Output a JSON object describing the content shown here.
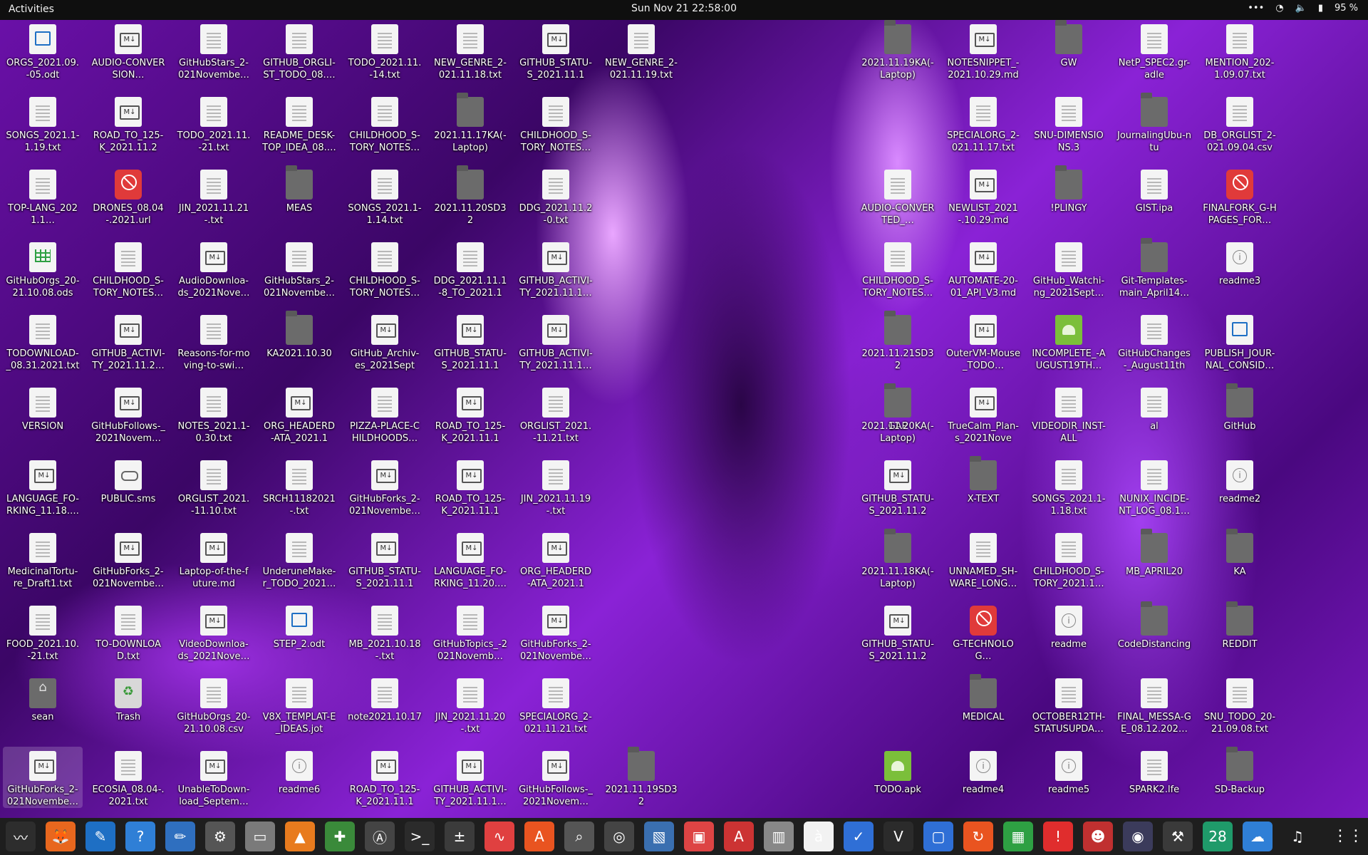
{
  "topbar": {
    "activities": "Activities",
    "clock": "Sun Nov 21  22:58:00",
    "battery": "95 %"
  },
  "desktop": {
    "icons": [
      {
        "label": "ORGS_2021.09.-05.odt",
        "type": "odt"
      },
      {
        "label": "AUDIO-CONVERSION…",
        "type": "md"
      },
      {
        "label": "GitHubStars_2-021Novembe…",
        "type": "doc"
      },
      {
        "label": "GITHUB_ORGLI-ST_TODO_08.…",
        "type": "doc"
      },
      {
        "label": "TODO_2021.11.-14.txt",
        "type": "doc"
      },
      {
        "label": "NEW_GENRE_2-021.11.18.txt",
        "type": "doc"
      },
      {
        "label": "GITHUB_STATU-S_2021.11.19.…",
        "type": "md"
      },
      {
        "label": "NEW_GENRE_2-021.11.19.txt",
        "type": "doc"
      },
      {
        "label": "2021.11.19KA(-Laptop)",
        "type": "folder"
      },
      {
        "label": "NOTESNIPPET_-2021.10.29.md",
        "type": "md"
      },
      {
        "label": "GW",
        "type": "folder"
      },
      {
        "label": "NetP_SPEC2.gr-adle",
        "type": "doc"
      },
      {
        "label": "MENTION_202-1.09.07.txt",
        "type": "doc"
      },
      {
        "label": "SONGS_2021.1-1.19.txt",
        "type": "doc"
      },
      {
        "label": "ROAD_TO_125-K_2021.11.20.…",
        "type": "md"
      },
      {
        "label": "TODO_2021.11.-21.txt",
        "type": "doc"
      },
      {
        "label": "README_DESK-TOP_IDEA_08.…",
        "type": "doc"
      },
      {
        "label": "CHILDHOOD_S-TORY_NOTES…",
        "type": "doc"
      },
      {
        "label": "2021.11.17KA(-Laptop)",
        "type": "folder"
      },
      {
        "label": "CHILDHOOD_S-TORY_NOTES…",
        "type": "doc"
      },
      {
        "label": "SPECIALORG_2-021.11.17.txt",
        "type": "doc"
      },
      {
        "label": "SNU-DIMENSIONS.3",
        "type": "doc"
      },
      {
        "label": "JournalingUbu-ntu",
        "type": "folder"
      },
      {
        "label": "DB_ORGLIST_2-021.09.04.csv",
        "type": "doc"
      },
      {
        "label": "TOP-LANG_2021.1…",
        "type": "doc"
      },
      {
        "label": "DRONES_08.04-.2021.url",
        "type": "blocked"
      },
      {
        "label": "JIN_2021.11.21-.txt",
        "type": "doc"
      },
      {
        "label": "MEAS",
        "type": "folder"
      },
      {
        "label": "SONGS_2021.1-1.14.txt",
        "type": "doc"
      },
      {
        "label": "2021.11.20SD32",
        "type": "folder"
      },
      {
        "label": "DDG_2021.11.2-0.txt",
        "type": "doc"
      },
      {
        "label": "AUDIO-CONVERTED_…",
        "type": "doc"
      },
      {
        "label": "NEWLIST_2021-.10.29.md",
        "type": "md"
      },
      {
        "label": "!PLINGY",
        "type": "folder"
      },
      {
        "label": "GIST.ipa",
        "type": "doc"
      },
      {
        "label": "FINALFORK_G-HPAGES_FOR…",
        "type": "blocked"
      },
      {
        "label": "GitHubOrgs_20-21.10.08.ods",
        "type": "ods"
      },
      {
        "label": "CHILDHOOD_S-TORY_NOTES…",
        "type": "doc"
      },
      {
        "label": "AudioDownloa-ds_2021Nove…",
        "type": "md"
      },
      {
        "label": "GitHubStars_2-021Novembe…",
        "type": "doc"
      },
      {
        "label": "CHILDHOOD_S-TORY_NOTES…",
        "type": "doc"
      },
      {
        "label": "DDG_2021.11.1-8_TO_2021.11…",
        "type": "doc"
      },
      {
        "label": "GITHUB_ACTIVI-TY_2021.11.1…",
        "type": "md"
      },
      {
        "label": "CHILDHOOD_S-TORY_NOTES…",
        "type": "doc"
      },
      {
        "label": "AUTOMATE-20-01_API_V3.md",
        "type": "md"
      },
      {
        "label": "GitHub_Watchi-ng_2021Sept…",
        "type": "doc"
      },
      {
        "label": "Git-Templates-main_April14…",
        "type": "folder"
      },
      {
        "label": "readme3",
        "type": "info"
      },
      {
        "label": "TODOWNLOAD-_08.31.2021.txt",
        "type": "doc"
      },
      {
        "label": "GITHUB_ACTIVI-TY_2021.11.2…",
        "type": "md"
      },
      {
        "label": "Reasons-for-moving-to-swi…",
        "type": "doc"
      },
      {
        "label": "KA2021.10.30",
        "type": "folder"
      },
      {
        "label": "GitHub_Archiv-es_2021Septe…",
        "type": "md"
      },
      {
        "label": "GITHUB_STATU-S_2021.11.18.…",
        "type": "md"
      },
      {
        "label": "GITHUB_ACTIVI-TY_2021.11.1…",
        "type": "md"
      },
      {
        "label": "2021.11.21SD32",
        "type": "folder"
      },
      {
        "label": "OuterVM-Mouse_TODO…",
        "type": "md"
      },
      {
        "label": "INCOMPLETE_-AUGUST19TH…",
        "type": "apk"
      },
      {
        "label": "GitHubChanges-_August11th2…",
        "type": "doc"
      },
      {
        "label": "PUBLISH_JOUR-NAL_CONSID…",
        "type": "odt"
      },
      {
        "label": "VERSION",
        "type": "doc"
      },
      {
        "label": "GitHubFollows-_2021Novem…",
        "type": "md"
      },
      {
        "label": "NOTES_2021.1-0.30.txt",
        "type": "doc"
      },
      {
        "label": "ORG_HEADERD-ATA_2021.11.…",
        "type": "md"
      },
      {
        "label": "PIZZA-PLACE-CHILDHOODS…",
        "type": "doc"
      },
      {
        "label": "ROAD_TO_125-K_2021.11.18.…",
        "type": "md"
      },
      {
        "label": "ORGLIST_2021.-11.21.txt",
        "type": "doc"
      },
      {
        "label": "GAP",
        "type": "folder"
      },
      {
        "label": "2021.11.20KA(-Laptop)",
        "type": "folder"
      },
      {
        "label": "TrueCalm_Plan-s_2021Novem…",
        "type": "md"
      },
      {
        "label": "VIDEODIR_INST-ALL",
        "type": "doc"
      },
      {
        "label": "al",
        "type": "doc"
      },
      {
        "label": "GitHub",
        "type": "folder"
      },
      {
        "label": "LANGUAGE_FO-RKING_11.18.…",
        "type": "md"
      },
      {
        "label": "PUBLIC.sms",
        "type": "sms"
      },
      {
        "label": "ORGLIST_2021.-11.10.txt",
        "type": "doc"
      },
      {
        "label": "SRCH11182021-.txt",
        "type": "doc"
      },
      {
        "label": "GitHubForks_2-021Novembe…",
        "type": "md"
      },
      {
        "label": "ROAD_TO_125-K_2021.11.19.…",
        "type": "md"
      },
      {
        "label": "JIN_2021.11.19-.txt",
        "type": "doc"
      },
      {
        "label": "GITHUB_STATU-S_2021.11.20.…",
        "type": "md"
      },
      {
        "label": "X-TEXT",
        "type": "folder"
      },
      {
        "label": "SONGS_2021.1-1.18.txt",
        "type": "doc"
      },
      {
        "label": "NUNIX_INCIDE-NT_LOG_08.1…",
        "type": "doc"
      },
      {
        "label": "readme2",
        "type": "info"
      },
      {
        "label": "MedicinalTortu-re_Draft1.txt",
        "type": "doc"
      },
      {
        "label": "GitHubForks_2-021Novembe…",
        "type": "md"
      },
      {
        "label": "Laptop-of-the-future.md",
        "type": "md"
      },
      {
        "label": "UnderuneMake-r_TODO_2021…",
        "type": "doc"
      },
      {
        "label": "GITHUB_STATU-S_2021.11.17.…",
        "type": "md"
      },
      {
        "label": "LANGUAGE_FO-RKING_11.20.…",
        "type": "md"
      },
      {
        "label": "ORG_HEADERD-ATA_2021.11.…",
        "type": "md"
      },
      {
        "label": "2021.11.18KA(-Laptop)",
        "type": "folder"
      },
      {
        "label": "UNNAMED_SH-WARE_LONG…",
        "type": "doc"
      },
      {
        "label": "CHILDHOOD_S-TORY_2021.1…",
        "type": "doc"
      },
      {
        "label": "MB_APRIL20",
        "type": "folder"
      },
      {
        "label": "KA",
        "type": "folder"
      },
      {
        "label": "FOOD_2021.10.-21.txt",
        "type": "doc"
      },
      {
        "label": "TO-DOWNLOAD.txt",
        "type": "doc"
      },
      {
        "label": "VideoDownloa-ds_2021Nove…",
        "type": "md"
      },
      {
        "label": "STEP_2.odt",
        "type": "odt"
      },
      {
        "label": "MB_2021.10.18-.txt",
        "type": "doc"
      },
      {
        "label": "GitHubTopics_-2021Novemb…",
        "type": "doc"
      },
      {
        "label": "GitHubForks_2-021Novembe…",
        "type": "md"
      },
      {
        "label": "GITHUB_STATU-S_2021.11.21.…",
        "type": "md"
      },
      {
        "label": "G-TECHNOLOG…",
        "type": "blocked"
      },
      {
        "label": "readme",
        "type": "info"
      },
      {
        "label": "CodeDistancing",
        "type": "folder"
      },
      {
        "label": "REDDIT",
        "type": "folder"
      },
      {
        "label": "sean",
        "type": "home"
      },
      {
        "label": "Trash",
        "type": "trash"
      },
      {
        "label": "GitHubOrgs_20-21.10.08.csv",
        "type": "doc"
      },
      {
        "label": "V8X_TEMPLAT-E_IDEAS.jot",
        "type": "doc"
      },
      {
        "label": "note2021.10.17",
        "type": "doc"
      },
      {
        "label": "JIN_2021.11.20-.txt",
        "type": "doc"
      },
      {
        "label": "SPECIALORG_2-021.11.21.txt",
        "type": "doc"
      },
      {
        "label": "MEDICAL",
        "type": "folder"
      },
      {
        "label": "OCTOBER12TH-STATUSUPDA…",
        "type": "doc"
      },
      {
        "label": "FINAL_MESSA-GE_08.12.202…",
        "type": "doc"
      },
      {
        "label": "SNU_TODO_20-21.09.08.txt",
        "type": "doc"
      },
      {
        "label": "GitHubForks_2-021Novembe…",
        "type": "md"
      },
      {
        "label": "ECOSIA_08.04-.2021.txt",
        "type": "doc"
      },
      {
        "label": "UnableToDown-load_Septem…",
        "type": "md"
      },
      {
        "label": "readme6",
        "type": "info"
      },
      {
        "label": "ROAD_TO_125-K_2021.11.17.…",
        "type": "md"
      },
      {
        "label": "GITHUB_ACTIVI-TY_2021.11.1…",
        "type": "md"
      },
      {
        "label": "GitHubFollows-_2021Novem…",
        "type": "md"
      },
      {
        "label": "2021.11.19SD32",
        "type": "folder"
      },
      {
        "label": "TODO.apk",
        "type": "apk"
      },
      {
        "label": "readme4",
        "type": "info"
      },
      {
        "label": "readme5",
        "type": "info"
      },
      {
        "label": "SPARK2.lfe",
        "type": "doc"
      },
      {
        "label": "SD-Backup",
        "type": "folder"
      }
    ]
  },
  "dock": {
    "apps": [
      {
        "name": "system-monitor-icon",
        "glyph": "〰",
        "color": "#2d2d2d"
      },
      {
        "name": "firefox-icon",
        "glyph": "🦊",
        "color": "#e8671e"
      },
      {
        "name": "writer-icon",
        "glyph": "✎",
        "color": "#1e6fc4"
      },
      {
        "name": "help-icon",
        "glyph": "?",
        "color": "#2f7fd6"
      },
      {
        "name": "text-editor-icon",
        "glyph": "✏",
        "color": "#2f6fbf"
      },
      {
        "name": "settings-icon",
        "glyph": "⚙",
        "color": "#555555"
      },
      {
        "name": "files-icon",
        "glyph": "▭",
        "color": "#7a7a7a"
      },
      {
        "name": "vlc-icon",
        "glyph": "▲",
        "color": "#e87b1e"
      },
      {
        "name": "extensions-icon",
        "glyph": "✚",
        "color": "#3a8a3a"
      },
      {
        "name": "software-updater-icon",
        "glyph": "Ⓐ",
        "color": "#444444"
      },
      {
        "name": "terminal-icon",
        "glyph": ">_",
        "color": "#2b2b2b"
      },
      {
        "name": "calculator-icon",
        "glyph": "±",
        "color": "#3b3b3b"
      },
      {
        "name": "monitor-icon",
        "glyph": "∿",
        "color": "#e04040"
      },
      {
        "name": "software-center-icon",
        "glyph": "A",
        "color": "#e95420"
      },
      {
        "name": "search-icon",
        "glyph": "⌕",
        "color": "#555555"
      },
      {
        "name": "disk-icon",
        "glyph": "◎",
        "color": "#444444"
      },
      {
        "name": "image-viewer-icon",
        "glyph": "▧",
        "color": "#3a6fb0"
      },
      {
        "name": "screenshot-icon",
        "glyph": "▣",
        "color": "#d44"
      },
      {
        "name": "font-viewer-icon",
        "glyph": "A",
        "color": "#c33"
      },
      {
        "name": "archive-icon",
        "glyph": "▥",
        "color": "#888888"
      },
      {
        "name": "characters-icon",
        "glyph": "à",
        "color": "#f2f2f2"
      },
      {
        "name": "tasks-icon",
        "glyph": "✓",
        "color": "#2f6fd6"
      },
      {
        "name": "vim-icon",
        "glyph": "V",
        "color": "#2b2b2b"
      },
      {
        "name": "remote-desktop-icon",
        "glyph": "▢",
        "color": "#2f6fd6"
      },
      {
        "name": "backup-icon",
        "glyph": "↻",
        "color": "#e95420"
      },
      {
        "name": "calc-icon",
        "glyph": "▦",
        "color": "#2ea043"
      },
      {
        "name": "alert-icon",
        "glyph": "!",
        "color": "#e02d2d"
      },
      {
        "name": "game-icon",
        "glyph": "☻",
        "color": "#c03030"
      },
      {
        "name": "webcam-icon",
        "glyph": "◉",
        "color": "#3b3b5b"
      },
      {
        "name": "tools-icon",
        "glyph": "⚒",
        "color": "#3a3a3a"
      },
      {
        "name": "calendar-icon",
        "glyph": "28",
        "color": "#1f9a6a"
      },
      {
        "name": "chat-icon",
        "glyph": "☁",
        "color": "#2f7fd6"
      },
      {
        "name": "music-icon",
        "glyph": "♫",
        "color": "#1e1e1e"
      }
    ]
  }
}
